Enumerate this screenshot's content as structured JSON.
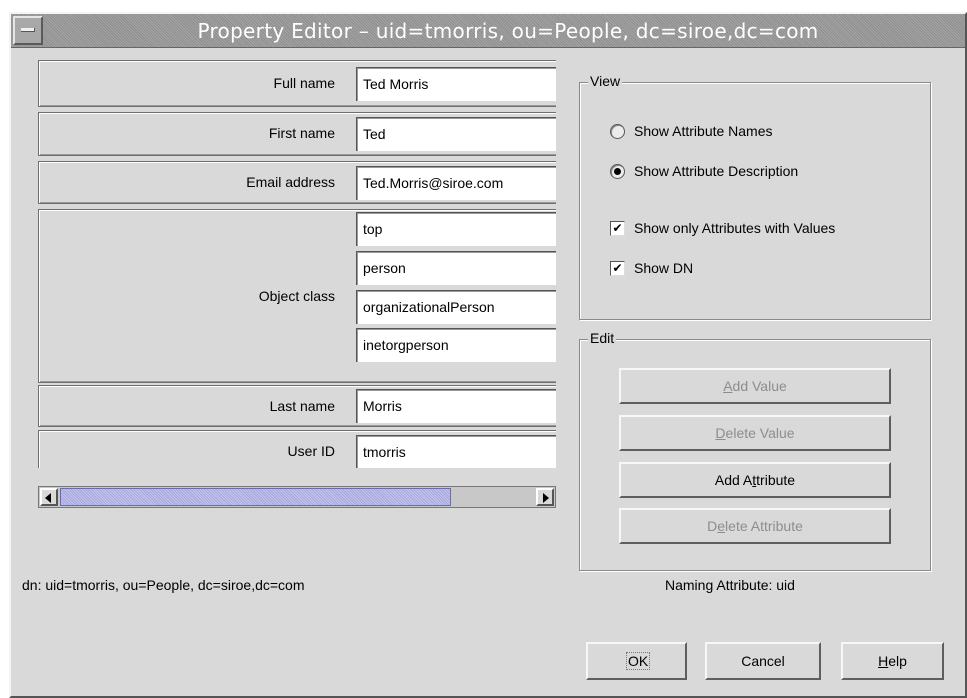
{
  "window": {
    "title": "Property Editor – uid=tmorris, ou=People, dc=siroe,dc=com"
  },
  "properties": {
    "full_name": {
      "label": "Full name",
      "value": "Ted Morris"
    },
    "first_name": {
      "label": "First name",
      "value": "Ted"
    },
    "email": {
      "label": "Email address",
      "value": "Ted.Morris@siroe.com"
    },
    "object_class": {
      "label": "Object class",
      "values": [
        "top",
        "person",
        "organizationalPerson",
        "inetorgperson"
      ]
    },
    "last_name": {
      "label": "Last name",
      "value": "Morris"
    },
    "user_id": {
      "label": "User ID",
      "value": "tmorris"
    }
  },
  "dn_text": "dn: uid=tmorris, ou=People, dc=siroe,dc=com",
  "view": {
    "label": "View",
    "show_attribute_names": {
      "label": "Show Attribute Names",
      "selected": false
    },
    "show_attribute_description": {
      "label": "Show Attribute Description",
      "selected": true
    },
    "show_only_with_values": {
      "label": "Show only Attributes with Values",
      "checked": true
    },
    "show_dn": {
      "label": "Show DN",
      "checked": true
    }
  },
  "edit": {
    "label": "Edit",
    "add_value": {
      "pre": "",
      "mnemonic": "A",
      "post": "dd Value",
      "enabled": false
    },
    "delete_value": {
      "pre": "",
      "mnemonic": "D",
      "post": "elete Value",
      "enabled": false
    },
    "add_attribute": {
      "pre": "Add A",
      "mnemonic": "t",
      "post": "tribute",
      "enabled": true
    },
    "delete_attribute": {
      "pre": "D",
      "mnemonic": "e",
      "post": "lete Attribute",
      "enabled": false
    }
  },
  "naming_attribute": "Naming Attribute: uid",
  "buttons": {
    "ok": "OK",
    "cancel": "Cancel",
    "help_mnemonic": "H",
    "help_rest": "elp"
  },
  "colors": {
    "window_bg": "#d9d9d9",
    "title_text": "#ffffff",
    "scroll_thumb": "#b5b5e6",
    "disabled_text": "#8d8d8d"
  }
}
